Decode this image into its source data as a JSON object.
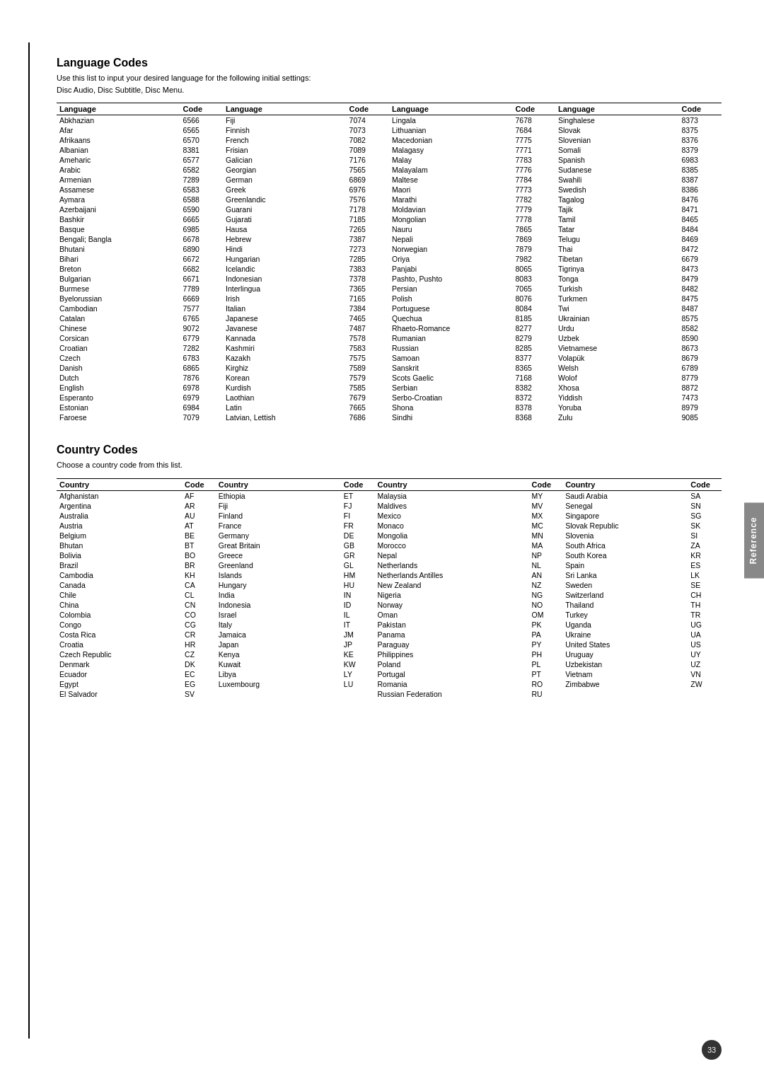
{
  "page": {
    "side_tab": "Reference",
    "page_number": "33"
  },
  "language_codes": {
    "title": "Language Codes",
    "description_line1": "Use this list to input your desired language for the following initial settings:",
    "description_line2": "Disc Audio, Disc Subtitle, Disc Menu.",
    "columns": [
      "Language",
      "Code",
      "Language",
      "Code",
      "Language",
      "Code",
      "Language",
      "Code"
    ],
    "data": [
      [
        "Abkhazian",
        "6566",
        "Fiji",
        "7074",
        "Lingala",
        "7678",
        "Singhalese",
        "8373"
      ],
      [
        "Afar",
        "6565",
        "Finnish",
        "7073",
        "Lithuanian",
        "7684",
        "Slovak",
        "8375"
      ],
      [
        "Afrikaans",
        "6570",
        "French",
        "7082",
        "Macedonian",
        "7775",
        "Slovenian",
        "8376"
      ],
      [
        "Albanian",
        "8381",
        "Frisian",
        "7089",
        "Malagasy",
        "7771",
        "Somali",
        "8379"
      ],
      [
        "Ameharic",
        "6577",
        "Galician",
        "7176",
        "Malay",
        "7783",
        "Spanish",
        "6983"
      ],
      [
        "Arabic",
        "6582",
        "Georgian",
        "7565",
        "Malayalam",
        "7776",
        "Sudanese",
        "8385"
      ],
      [
        "Armenian",
        "7289",
        "German",
        "6869",
        "Maltese",
        "7784",
        "Swahili",
        "8387"
      ],
      [
        "Assamese",
        "6583",
        "Greek",
        "6976",
        "Maori",
        "7773",
        "Swedish",
        "8386"
      ],
      [
        "Aymara",
        "6588",
        "Greenlandic",
        "7576",
        "Marathi",
        "7782",
        "Tagalog",
        "8476"
      ],
      [
        "Azerbaijani",
        "6590",
        "Guarani",
        "7178",
        "Moldavian",
        "7779",
        "Tajik",
        "8471"
      ],
      [
        "Bashkir",
        "6665",
        "Gujarati",
        "7185",
        "Mongolian",
        "7778",
        "Tamil",
        "8465"
      ],
      [
        "Basque",
        "6985",
        "Hausa",
        "7265",
        "Nauru",
        "7865",
        "Tatar",
        "8484"
      ],
      [
        "Bengali; Bangla",
        "6678",
        "Hebrew",
        "7387",
        "Nepali",
        "7869",
        "Telugu",
        "8469"
      ],
      [
        "Bhutani",
        "6890",
        "Hindi",
        "7273",
        "Norwegian",
        "7879",
        "Thai",
        "8472"
      ],
      [
        "Bihari",
        "6672",
        "Hungarian",
        "7285",
        "Oriya",
        "7982",
        "Tibetan",
        "6679"
      ],
      [
        "Breton",
        "6682",
        "Icelandic",
        "7383",
        "Panjabi",
        "8065",
        "Tigrinya",
        "8473"
      ],
      [
        "Bulgarian",
        "6671",
        "Indonesian",
        "7378",
        "Pashto, Pushto",
        "8083",
        "Tonga",
        "8479"
      ],
      [
        "Burmese",
        "7789",
        "Interlingua",
        "7365",
        "Persian",
        "7065",
        "Turkish",
        "8482"
      ],
      [
        "Byelorussian",
        "6669",
        "Irish",
        "7165",
        "Polish",
        "8076",
        "Turkmen",
        "8475"
      ],
      [
        "Cambodian",
        "7577",
        "Italian",
        "7384",
        "Portuguese",
        "8084",
        "Twi",
        "8487"
      ],
      [
        "Catalan",
        "6765",
        "Japanese",
        "7465",
        "Quechua",
        "8185",
        "Ukrainian",
        "8575"
      ],
      [
        "Chinese",
        "9072",
        "Javanese",
        "7487",
        "Rhaeto-Romance",
        "8277",
        "Urdu",
        "8582"
      ],
      [
        "Corsican",
        "6779",
        "Kannada",
        "7578",
        "Rumanian",
        "8279",
        "Uzbek",
        "8590"
      ],
      [
        "Croatian",
        "7282",
        "Kashmiri",
        "7583",
        "Russian",
        "8285",
        "Vietnamese",
        "8673"
      ],
      [
        "Czech",
        "6783",
        "Kazakh",
        "7575",
        "Samoan",
        "8377",
        "Volapük",
        "8679"
      ],
      [
        "Danish",
        "6865",
        "Kirghiz",
        "7589",
        "Sanskrit",
        "8365",
        "Welsh",
        "6789"
      ],
      [
        "Dutch",
        "7876",
        "Korean",
        "7579",
        "Scots Gaelic",
        "7168",
        "Wolof",
        "8779"
      ],
      [
        "English",
        "6978",
        "Kurdish",
        "7585",
        "Serbian",
        "8382",
        "Xhosa",
        "8872"
      ],
      [
        "Esperanto",
        "6979",
        "Laothian",
        "7679",
        "Serbo-Croatian",
        "8372",
        "Yiddish",
        "7473"
      ],
      [
        "Estonian",
        "6984",
        "Latin",
        "7665",
        "Shona",
        "8378",
        "Yoruba",
        "8979"
      ],
      [
        "Faroese",
        "7079",
        "Latvian, Lettish",
        "7686",
        "Sindhi",
        "8368",
        "Zulu",
        "9085"
      ]
    ]
  },
  "country_codes": {
    "title": "Country Codes",
    "description": "Choose a country code from this list.",
    "columns": [
      "Country",
      "Code",
      "Country",
      "Code",
      "Country",
      "Code",
      "Country",
      "Code"
    ],
    "data": [
      [
        "Afghanistan",
        "AF",
        "Ethiopia",
        "ET",
        "Malaysia",
        "MY",
        "Saudi Arabia",
        "SA"
      ],
      [
        "Argentina",
        "AR",
        "Fiji",
        "FJ",
        "Maldives",
        "MV",
        "Senegal",
        "SN"
      ],
      [
        "Australia",
        "AU",
        "Finland",
        "FI",
        "Mexico",
        "MX",
        "Singapore",
        "SG"
      ],
      [
        "Austria",
        "AT",
        "France",
        "FR",
        "Monaco",
        "MC",
        "Slovak Republic",
        "SK"
      ],
      [
        "Belgium",
        "BE",
        "Germany",
        "DE",
        "Mongolia",
        "MN",
        "Slovenia",
        "SI"
      ],
      [
        "Bhutan",
        "BT",
        "Great Britain",
        "GB",
        "Morocco",
        "MA",
        "South Africa",
        "ZA"
      ],
      [
        "Bolivia",
        "BO",
        "Greece",
        "GR",
        "Nepal",
        "NP",
        "South Korea",
        "KR"
      ],
      [
        "Brazil",
        "BR",
        "Greenland",
        "GL",
        "Netherlands",
        "NL",
        "Spain",
        "ES"
      ],
      [
        "Cambodia",
        "KH",
        "Islands",
        "HM",
        "Netherlands Antilles",
        "AN",
        "Sri Lanka",
        "LK"
      ],
      [
        "Canada",
        "CA",
        "Hungary",
        "HU",
        "New Zealand",
        "NZ",
        "Sweden",
        "SE"
      ],
      [
        "Chile",
        "CL",
        "India",
        "IN",
        "Nigeria",
        "NG",
        "Switzerland",
        "CH"
      ],
      [
        "China",
        "CN",
        "Indonesia",
        "ID",
        "Norway",
        "NO",
        "Thailand",
        "TH"
      ],
      [
        "Colombia",
        "CO",
        "Israel",
        "IL",
        "Oman",
        "OM",
        "Turkey",
        "TR"
      ],
      [
        "Congo",
        "CG",
        "Italy",
        "IT",
        "Pakistan",
        "PK",
        "Uganda",
        "UG"
      ],
      [
        "Costa Rica",
        "CR",
        "Jamaica",
        "JM",
        "Panama",
        "PA",
        "Ukraine",
        "UA"
      ],
      [
        "Croatia",
        "HR",
        "Japan",
        "JP",
        "Paraguay",
        "PY",
        "United States",
        "US"
      ],
      [
        "Czech Republic",
        "CZ",
        "Kenya",
        "KE",
        "Philippines",
        "PH",
        "Uruguay",
        "UY"
      ],
      [
        "Denmark",
        "DK",
        "Kuwait",
        "KW",
        "Poland",
        "PL",
        "Uzbekistan",
        "UZ"
      ],
      [
        "Ecuador",
        "EC",
        "Libya",
        "LY",
        "Portugal",
        "PT",
        "Vietnam",
        "VN"
      ],
      [
        "Egypt",
        "EG",
        "Luxembourg",
        "LU",
        "Romania",
        "RO",
        "Zimbabwe",
        "ZW"
      ],
      [
        "El Salvador",
        "SV",
        "",
        "",
        "Russian Federation",
        "RU",
        "",
        ""
      ]
    ]
  }
}
